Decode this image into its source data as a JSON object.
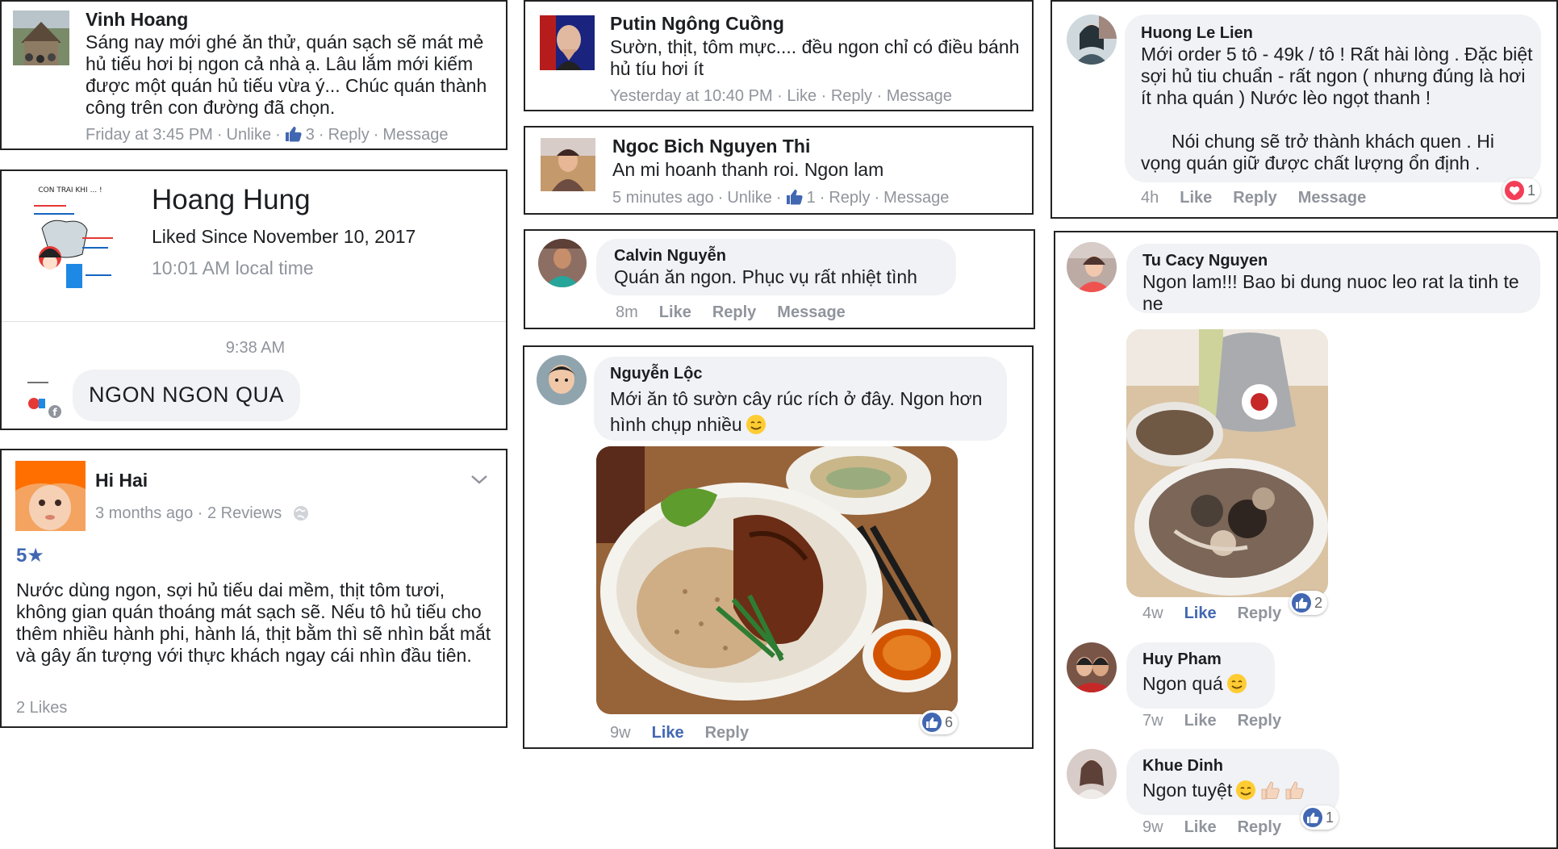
{
  "colors": {
    "fb_blue": "#4267b2",
    "gray_text": "#90949c",
    "bubble": "#f0f2f5",
    "heart_red": "#f33e58"
  },
  "p1": {
    "name": "Vinh Hoang",
    "body": "Sáng nay mới ghé ăn thử, quán sạch sẽ mát mẻ hủ tiếu hơi bị ngon cả nhà ạ. Lâu lắm mới kiếm được một quán hủ tiếu vừa ý... Chúc quán thành công trên con đường đã chọn.",
    "time": "Friday at 3:45 PM",
    "unlike": "Unlike",
    "likes": "3",
    "reply": "Reply",
    "message": "Message"
  },
  "p2": {
    "avatar_caption": "CON TRAI KHI ... !",
    "name": "Hoang Hung",
    "liked_since": "Liked Since November 10, 2017",
    "local_time": "10:01 AM local time",
    "msg_time": "9:38 AM",
    "message": "NGON NGON QUA"
  },
  "p3": {
    "name": "Hi Hai",
    "meta": "3 months ago · 2 Reviews",
    "rating": "5★",
    "body": "Nước dùng ngon, sợi hủ tiếu dai mềm, thịt tôm tươi, không gian quán thoáng mát sạch sẽ. Nếu tô hủ tiếu cho thêm nhiều hành phi, hành lá, thịt bằm thì sẽ nhìn bắt mắt và gây ấn tượng với thực khách ngay cái nhìn đầu tiên.",
    "likes": "2 Likes"
  },
  "p4": {
    "name": "Putin Ngông Cuồng",
    "body": "Sườn, thịt, tôm mực.... đều ngon chỉ có điều bánh hủ tíu hơi ít",
    "meta": "Yesterday at 10:40 PM · Like · Reply · Message"
  },
  "p5": {
    "name": "Ngoc Bich Nguyen Thi",
    "body": "An mi hoanh thanh roi. Ngon lam",
    "time": "5 minutes ago",
    "unlike": "Unlike",
    "likes": "1",
    "reply": "Reply",
    "message": "Message"
  },
  "p6": {
    "name": "Calvin Nguyễn",
    "body": "Quán ăn ngon. Phục vụ rất nhiệt tình",
    "time": "8m",
    "like": "Like",
    "reply": "Reply",
    "message": "Message"
  },
  "p7": {
    "name": "Nguyễn Lộc",
    "body": "Mới ăn tô sườn cây rúc rích ở đây. Ngon hơn hình chụp nhiều",
    "time": "9w",
    "like": "Like",
    "reply": "Reply",
    "reaction_count": "6"
  },
  "p8": {
    "name": "Huong Le Lien",
    "body1": "Mới order 5 tô - 49k / tô ! Rất hài lòng . Đặc biệt sợi hủ tiu chuẩn - rất ngon ( nhưng đúng là hơi ít nha quán ) Nước lèo ngọt thanh !",
    "body2": "Nói chung sẽ trở thành khách quen . Hi vọng quán giữ được chất lượng ổn định .",
    "time": "4h",
    "like": "Like",
    "reply": "Reply",
    "message": "Message",
    "reaction_count": "1"
  },
  "p9": {
    "c1": {
      "name": "Tu Cacy Nguyen",
      "body": "Ngon lam!!! Bao bi dung nuoc leo rat la tinh te ne",
      "time": "4w",
      "like": "Like",
      "reply": "Reply",
      "reaction_count": "2"
    },
    "c2": {
      "name": "Huy Pham",
      "body": "Ngon quá",
      "time": "7w",
      "like": "Like",
      "reply": "Reply"
    },
    "c3": {
      "name": "Khue Dinh",
      "body": "Ngon tuyệt",
      "time": "9w",
      "like": "Like",
      "reply": "Reply",
      "reaction_count": "1"
    }
  }
}
